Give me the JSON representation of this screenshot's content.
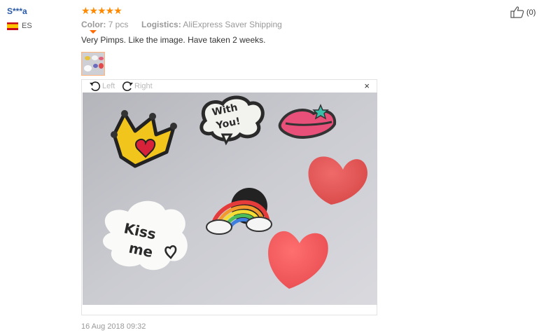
{
  "reviewer": {
    "name": "S***a",
    "country": "ES"
  },
  "rating": {
    "stars": 5,
    "display": "★★★★★"
  },
  "meta": {
    "color_label": "Color:",
    "color_value": "7 pcs",
    "logistics_label": "Logistics:",
    "logistics_value": "AliExpress Saver Shipping"
  },
  "review_text": "Very Pimps. Like the image. Have taken 2 weeks.",
  "viewer": {
    "rotate_left": "Left",
    "rotate_right": "Right",
    "close": "×"
  },
  "photo": {
    "cloud_text_1": "With",
    "cloud_text_2": "You!",
    "kiss_text_1": "Kiss",
    "kiss_text_2": "me"
  },
  "date": "16 Aug 2018 09:32",
  "helpful": {
    "count": "(0)"
  },
  "colors": {
    "star": "#ff8a00",
    "username": "#2a5aa8",
    "thumb_border": "#ffb27a"
  }
}
